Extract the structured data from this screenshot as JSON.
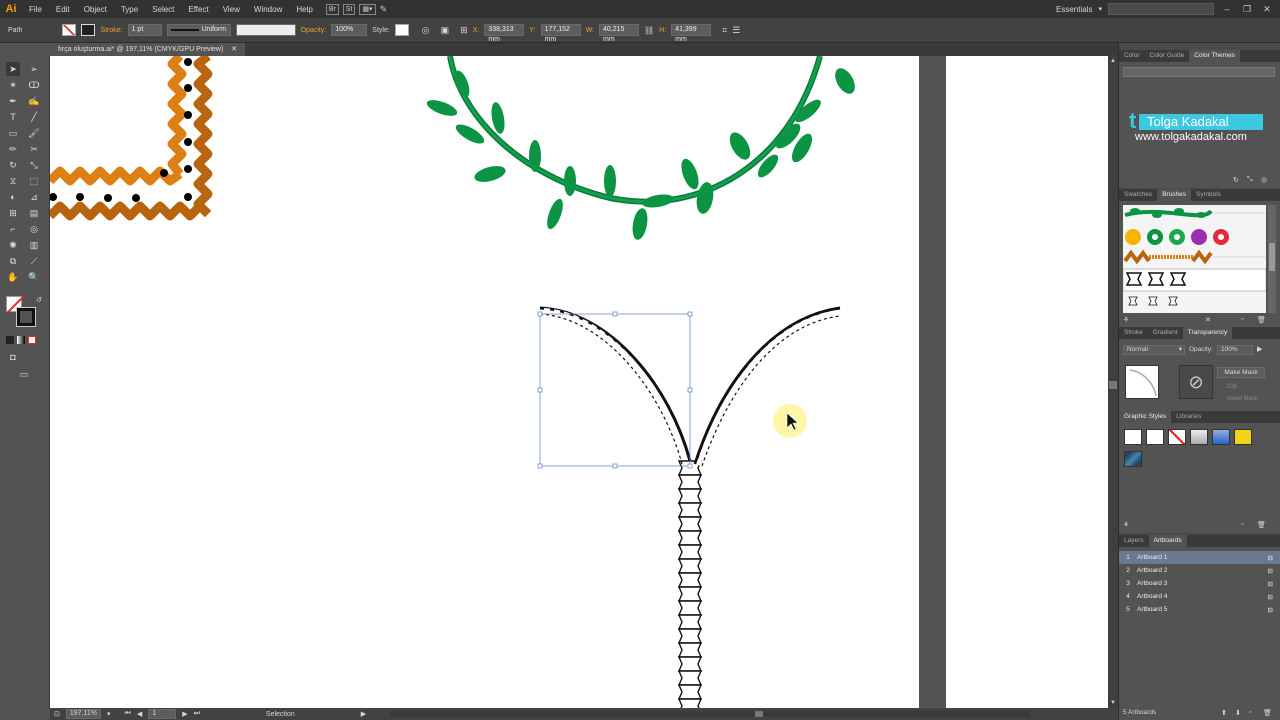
{
  "menubar": {
    "app_logo": "Ai",
    "items": [
      "File",
      "Edit",
      "Object",
      "Type",
      "Select",
      "Effect",
      "View",
      "Window",
      "Help"
    ],
    "bridge_badges": [
      "Br",
      "St"
    ],
    "workspace": "Essentials"
  },
  "controlbar": {
    "selection_type": "Path",
    "stroke_label": "Stroke:",
    "stroke_weight": "1 pt",
    "profile": "Uniform",
    "opacity_label": "Opacity:",
    "opacity_value": "100%",
    "style_label": "Style:",
    "x_label": "X:",
    "x_value": "338,313 mm",
    "y_label": "Y:",
    "y_value": "177,152 mm",
    "w_label": "W:",
    "w_value": "40,215 mm",
    "h_label": "H:",
    "h_value": "41,399 mm"
  },
  "document": {
    "tab_title": "fırça oluşturma.ai* @ 197,11% (CMYK/GPU Preview)"
  },
  "statusbar": {
    "zoom": "197,11%",
    "artboard_num": "1",
    "tool_name": "Selection"
  },
  "panels": {
    "color_tabs": [
      "Color",
      "Color Guide",
      "Color Themes"
    ],
    "logo_name": "Tolga Kadakal",
    "logo_url": "www.tolgakadakal.com",
    "brush_tabs": [
      "Swatches",
      "Brushes",
      "Symbols"
    ],
    "transparency_tabs": [
      "Stroke",
      "Gradient",
      "Transparency"
    ],
    "blend_mode": "Normal",
    "opacity_label": "Opacity:",
    "opacity_value": "100%",
    "make_mask": "Make Mask",
    "clip": "Clip",
    "invert_mask": "Invert Mask",
    "gs_tabs": [
      "Graphic Styles",
      "Libraries"
    ],
    "layers_tabs": [
      "Layers",
      "Artboards"
    ],
    "artboards": [
      {
        "num": "1",
        "name": "Artboard 1"
      },
      {
        "num": "2",
        "name": "Artboard 2"
      },
      {
        "num": "3",
        "name": "Artboard 3"
      },
      {
        "num": "4",
        "name": "Artboard 4"
      },
      {
        "num": "5",
        "name": "Artboard 5"
      }
    ],
    "artboards_count": "5 Artboards"
  },
  "colors": {
    "vine_green": "#0a9444",
    "border_orange": "#d87a12",
    "selection_blue": "#6b8fc7",
    "cursor_highlight": "#fff59a"
  }
}
